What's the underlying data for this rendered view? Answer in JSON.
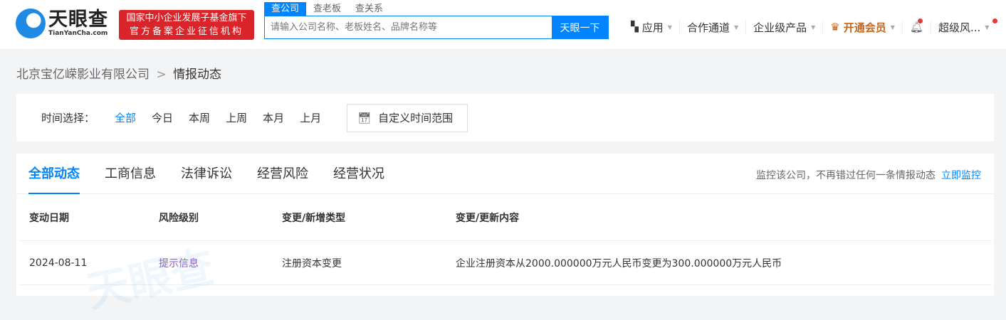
{
  "header": {
    "logo_cn": "天眼查",
    "logo_en": "TianYanCha.com",
    "badge_line1": "国家中小企业发展子基金旗下",
    "badge_line2": "官方备案企业征信机构",
    "search_tabs": [
      "查公司",
      "查老板",
      "查关系"
    ],
    "search_placeholder": "请输入公司名称、老板姓名、品牌名称等",
    "search_button": "天眼一下",
    "nav": {
      "apps": "应用",
      "partner": "合作通道",
      "enterprise": "企业级产品",
      "vip": "开通会员",
      "user": "超级风..."
    }
  },
  "breadcrumb": {
    "company": "北京宝亿嵘影业有限公司",
    "sep": ">",
    "current": "情报动态"
  },
  "filter": {
    "label": "时间选择：",
    "options": [
      "全部",
      "今日",
      "本周",
      "上周",
      "本月",
      "上月"
    ],
    "custom": "自定义时间范围"
  },
  "tabs": [
    "全部动态",
    "工商信息",
    "法律诉讼",
    "经营风险",
    "经营状况"
  ],
  "monitor": {
    "text": "监控该公司，不再错过任何一条情报动态",
    "link": "立即监控"
  },
  "table": {
    "headers": [
      "变动日期",
      "风险级别",
      "变更/新增类型",
      "变更/更新内容"
    ],
    "rows": [
      [
        "2024-08-11",
        "提示信息",
        "注册资本变更",
        "企业注册资本从2000.000000万元人民币变更为300.000000万元人民币"
      ]
    ]
  },
  "watermark": "天眼查"
}
